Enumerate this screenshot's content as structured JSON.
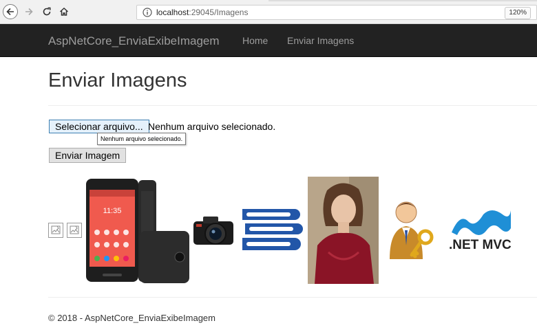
{
  "browser": {
    "url_host": "localhost",
    "url_path": ":29045/Imagens",
    "zoom": "120%"
  },
  "navbar": {
    "brand": "AspNetCore_EnviaExibeImagem",
    "links": [
      {
        "label": "Home"
      },
      {
        "label": "Enviar Imagens"
      }
    ]
  },
  "page": {
    "title": "Enviar Imagens"
  },
  "form": {
    "file_button": "Selecionar arquivo...",
    "file_status": "Nenhum arquivo selecionado.",
    "tooltip": "Nenhum arquivo selecionado.",
    "submit_label": "Enviar Imagem"
  },
  "gallery": {
    "dotnet_logo_text": ".NET MVC"
  },
  "footer": {
    "text": "© 2018 - AspNetCore_EnviaExibeImagem"
  },
  "colors": {
    "navbar_bg": "#222222",
    "navbar_text": "#9d9d9d",
    "dotnet_blue": "#1f8fd6"
  }
}
